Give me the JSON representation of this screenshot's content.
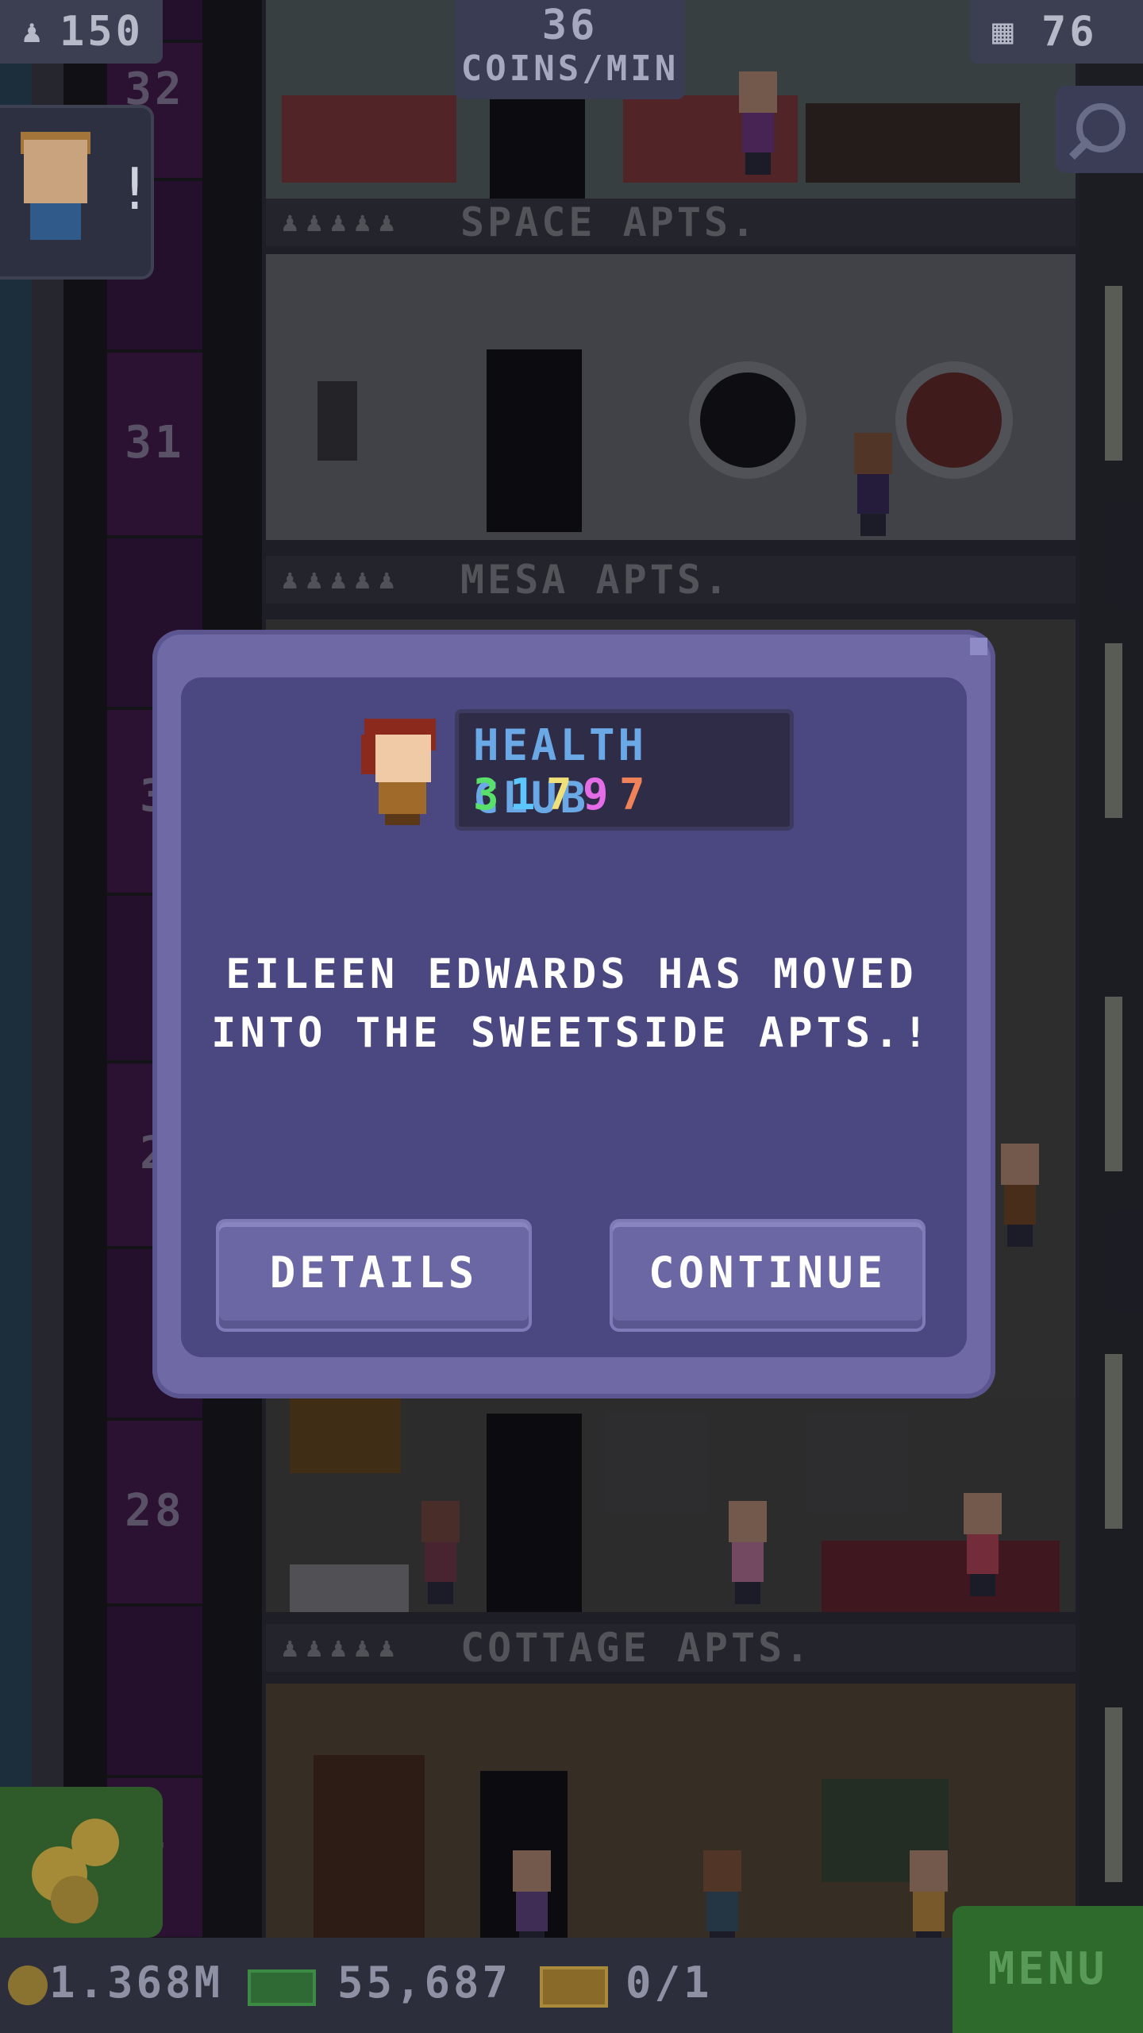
{
  "hud": {
    "population": "150",
    "coins_per_min_value": "36",
    "coins_per_min_label": "COINS/MIN",
    "floors": "76",
    "coins": "1.368M",
    "bux": "55,687",
    "tickets": "0/1",
    "menu_label": "MENU"
  },
  "tower": {
    "floor_names": [
      "SPACE APTS.",
      "MESA APTS.",
      "COTTAGE APTS."
    ],
    "elevator_numbers": [
      "32",
      "31",
      "3",
      "2",
      "28",
      "7"
    ],
    "tenant_dots": "♟♟♟♟♟"
  },
  "dialog": {
    "job_title": "HEALTH CLUB",
    "stats": [
      "3",
      "1",
      "7",
      "9",
      "7"
    ],
    "message_line1": "EILEEN EDWARDS HAS MOVED",
    "message_line2": "INTO THE SWEETSIDE APTS.!",
    "details_label": "DETAILS",
    "continue_label": "CONTINUE"
  },
  "colors": {
    "dialog_bg": "#4b4780",
    "dialog_frame": "#6f6aa6",
    "job_title": "#6aa8e6",
    "stat_colors": [
      "#58e06a",
      "#5cc6ff",
      "#f0e07a",
      "#e46ce6",
      "#f0825a"
    ]
  },
  "icons": [
    "population-icon",
    "floors-icon",
    "search-icon",
    "coin-icon",
    "bux-icon",
    "ticket-icon",
    "visitor-icon"
  ]
}
